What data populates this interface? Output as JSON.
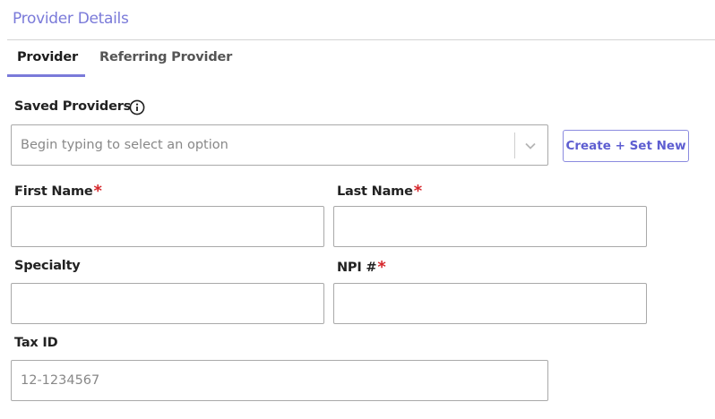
{
  "section": {
    "title": "Provider Details"
  },
  "tabs": [
    {
      "label": "Provider",
      "active": true
    },
    {
      "label": "Referring Provider",
      "active": false
    }
  ],
  "saved_providers": {
    "label": "Saved Providers",
    "placeholder": "Begin typing to select an option",
    "info_icon": "info-circle-icon",
    "dropdown_icon": "chevron-down-icon"
  },
  "create_button": {
    "label": "Create + Set New"
  },
  "fields": {
    "first_name": {
      "label": "First Name",
      "required_mark": "*",
      "value": ""
    },
    "last_name": {
      "label": "Last Name",
      "required_mark": "*",
      "value": ""
    },
    "specialty": {
      "label": "Specialty",
      "value": ""
    },
    "npi": {
      "label": "NPI #",
      "required_mark": "*",
      "value": ""
    },
    "tax_id": {
      "label": "Tax ID",
      "placeholder": "12-1234567",
      "value": ""
    }
  },
  "colors": {
    "accent": "#7a7ad9",
    "required": "#d6262b",
    "border": "#a9a9a9"
  }
}
